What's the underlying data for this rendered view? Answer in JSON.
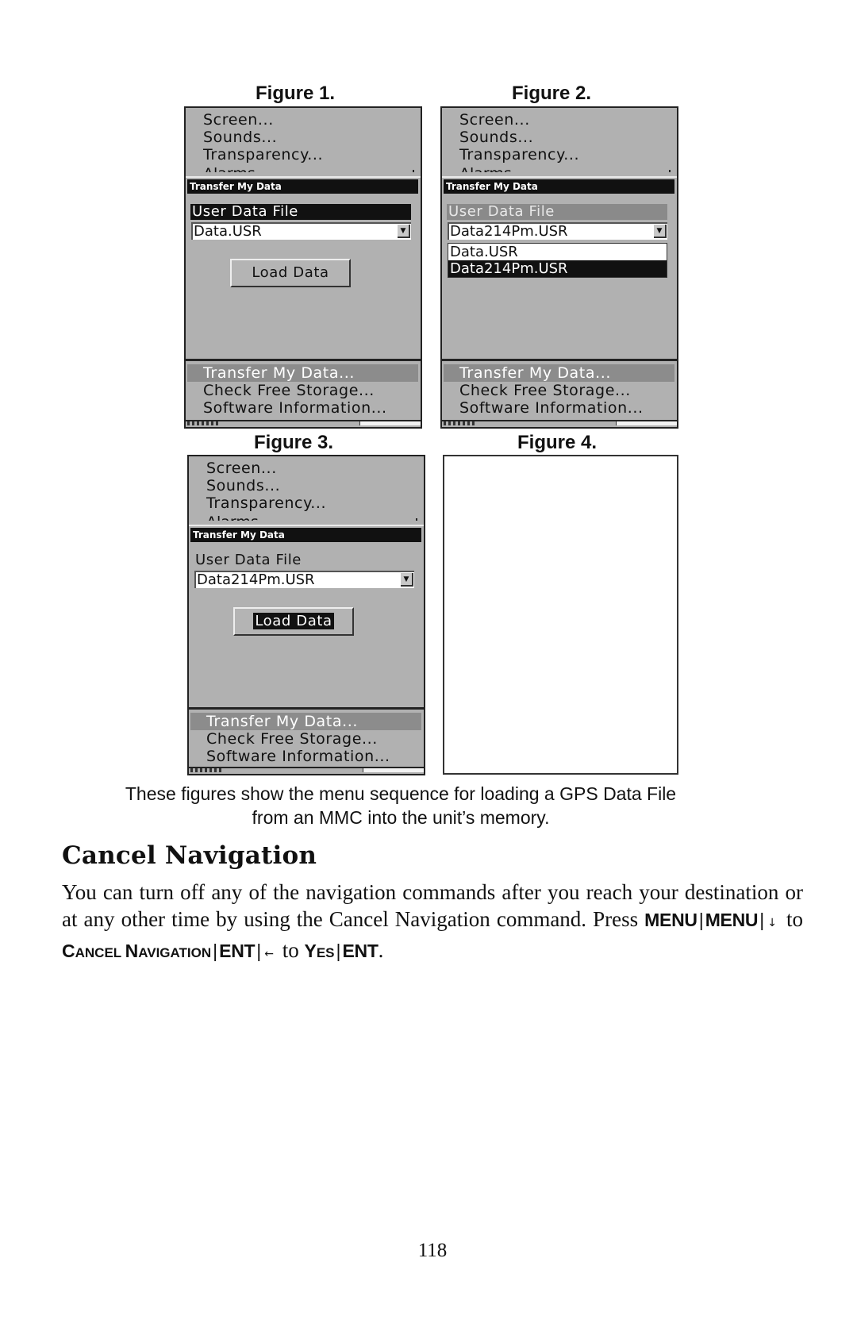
{
  "figures": [
    {
      "label": "Figure 1.",
      "top_menu": [
        "Screen...",
        "Sounds...",
        "Transparency...",
        "Alarms..."
      ],
      "dialog_title": "Transfer My Data",
      "field_label": "User Data File",
      "field_label_state": "selected",
      "selected_file": "Data.USR",
      "dropdown_open": false,
      "dropdown_options": [],
      "button_label": "Load Data",
      "button_focused": false,
      "bottom_menu": [
        "Transfer My Data...",
        "Check Free Storage...",
        "Software Information..."
      ],
      "bottom_menu_highlight": 0
    },
    {
      "label": "Figure 2.",
      "top_menu": [
        "Screen...",
        "Sounds...",
        "Transparency...",
        "Alarms..."
      ],
      "dialog_title": "Transfer My Data",
      "field_label": "User Data File",
      "field_label_state": "dimmed",
      "selected_file": "Data214Pm.USR",
      "dropdown_open": true,
      "dropdown_options": [
        "Data.USR",
        "Data214Pm.USR"
      ],
      "dropdown_active_index": 1,
      "button_label": "Load Data",
      "button_focused": false,
      "bottom_menu": [
        "Transfer My Data...",
        "Check Free Storage...",
        "Software Information..."
      ],
      "bottom_menu_highlight": 0
    },
    {
      "label": "Figure 3.",
      "top_menu": [
        "Screen...",
        "Sounds...",
        "Transparency...",
        "Alarms..."
      ],
      "dialog_title": "Transfer My Data",
      "field_label": "User Data File",
      "field_label_state": "plain",
      "selected_file": "Data214Pm.USR",
      "dropdown_open": false,
      "dropdown_options": [],
      "button_label": "Load Data",
      "button_focused": true,
      "bottom_menu": [
        "Transfer My Data...",
        "Check Free Storage...",
        "Software Information..."
      ],
      "bottom_menu_highlight": 0
    },
    {
      "label": "Figure 4.",
      "blank": true
    }
  ],
  "caption": {
    "line1": "These figures show the menu sequence for loading a GPS Data File",
    "line2": "from an MMC into the unit’s memory."
  },
  "section": {
    "title": "Cancel Navigation",
    "body_intro": "You can turn off any of the navigation commands after you reach your destination or at any other time by using the Cancel Navigation command. Press ",
    "keys": {
      "menu1": "MENU",
      "menu2": "MENU",
      "down_arrow": "↓",
      "to1": "to",
      "cancel_nav_c": "C",
      "cancel_nav_rest1": "ANCEL ",
      "cancel_nav_n": "N",
      "cancel_nav_rest2": "AVIGATION",
      "ent1": "ENT",
      "left_arrow": "←",
      "to2": "to",
      "yes_y": "Y",
      "yes_rest": "ES",
      "ent2": "ENT",
      "separator": "|",
      "end": "."
    }
  },
  "page_number": "118"
}
